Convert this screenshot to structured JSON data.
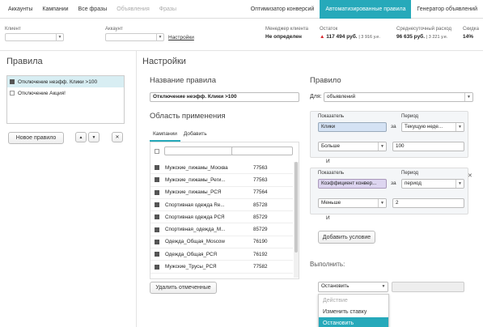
{
  "topnav": {
    "left": [
      "Аккаунты",
      "Кампании",
      "Все фразы",
      "Объявления",
      "Фразы"
    ],
    "right": [
      "Оптимизатор конверсий",
      "Автоматизированные правила",
      "Генератор объявлений"
    ],
    "active": "Автоматизированные правила"
  },
  "filters": {
    "client_label": "Клиент",
    "account_label": "Аккаунт",
    "settings_link": "Настройки",
    "manager_label": "Менеджер клиента",
    "manager_value": "Не определен",
    "balance_label": "Остаток",
    "balance_value": "117 494 руб.",
    "balance_sub": "| 3 916 у.е.",
    "avg_label": "Среднесуточный расход",
    "avg_value": "96 635 руб.",
    "avg_sub": "| 3 221 у.е.",
    "discount_label": "Скидка",
    "discount_value": "14%"
  },
  "rules_panel": {
    "title": "Правила",
    "items": [
      {
        "label": "Отключение неэфф. Клики >100",
        "selected": true
      },
      {
        "label": "Отключение Акция!",
        "selected": false
      }
    ],
    "new_rule_button": "Новое правило",
    "up_icon": "▲",
    "down_icon": "▼",
    "delete_icon": "✕"
  },
  "settings": {
    "title": "Настройки",
    "rule_name_label": "Название правила",
    "rule_name_value": "Отключение неэфф. Клики >100",
    "scope_label": "Область применения",
    "tabs": [
      "Кампании",
      "Добавить"
    ],
    "campaigns": [
      {
        "name": "Мужские_пижамы_Москва",
        "id": "77563"
      },
      {
        "name": "Мужские_пижамы_Реги...",
        "id": "77563"
      },
      {
        "name": "Мужские_пижамы_РСЯ",
        "id": "77564"
      },
      {
        "name": "Спортивная одежда Re...",
        "id": "85728"
      },
      {
        "name": "Спортивная одежда РСЯ",
        "id": "85729"
      },
      {
        "name": "Спортивная_одежда_М...",
        "id": "85729"
      },
      {
        "name": "Одежда_Общая_Moscow",
        "id": "76190"
      },
      {
        "name": "Одежда_Общая_РСЯ",
        "id": "76192"
      },
      {
        "name": "Мужские_Трусы_РСЯ",
        "id": "77582"
      }
    ],
    "delete_selected_button": "Удалить отмеченные"
  },
  "rule": {
    "title": "Правило",
    "for_label": "Для:",
    "for_value": "объявлений",
    "conditions": [
      {
        "metric_label": "Показатель",
        "period_label": "Период",
        "metric": "Клики",
        "for_word": "за",
        "period": "Текущую неде...",
        "operator": "Больше",
        "value": "100"
      },
      {
        "metric_label": "Показатель",
        "period_label": "Период",
        "metric": "Коэффициент конвер...",
        "for_word": "за",
        "period": "период",
        "operator": "Меньше",
        "value": "2"
      }
    ],
    "and_label": "И",
    "add_condition_button": "Добавить условие",
    "remove_condition_icon": "✕",
    "execute_label": "Выполнить:",
    "action_value": "Остановить",
    "dropdown": {
      "header": "Действие",
      "options": [
        "Изменить ставку",
        "Остановить"
      ],
      "highlighted": "Остановить"
    }
  }
}
